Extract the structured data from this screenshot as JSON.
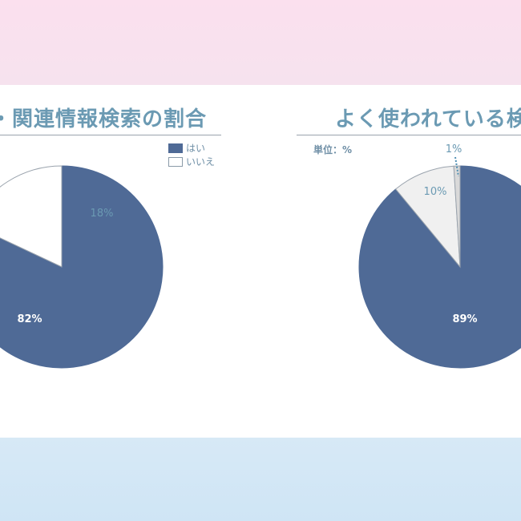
{
  "panel_left": {
    "title": "・関連情報検索の割合",
    "legend": [
      {
        "label": "はい",
        "color": "#4f6a96"
      },
      {
        "label": "いいえ",
        "color": "#ffffff"
      }
    ]
  },
  "panel_right": {
    "title": "よく使われている検",
    "unit_label": "単位：%"
  },
  "chart_data": [
    {
      "type": "pie",
      "title": "・関連情報検索の割合",
      "labels": [
        "はい",
        "いいえ"
      ],
      "values": [
        82,
        18
      ],
      "value_labels": [
        "82%",
        "18%"
      ],
      "colors": [
        "#4f6a96",
        "#ffffff"
      ],
      "legend_position": "top-right"
    },
    {
      "type": "pie",
      "title": "よく使われている検",
      "labels": [
        "",
        "",
        ""
      ],
      "values": [
        89,
        10,
        1
      ],
      "value_labels": [
        "89%",
        "10%",
        "1%"
      ],
      "colors": [
        "#4f6a96",
        "#f0f0f0",
        "#d9d9d9"
      ],
      "unit": "単位：%"
    }
  ]
}
